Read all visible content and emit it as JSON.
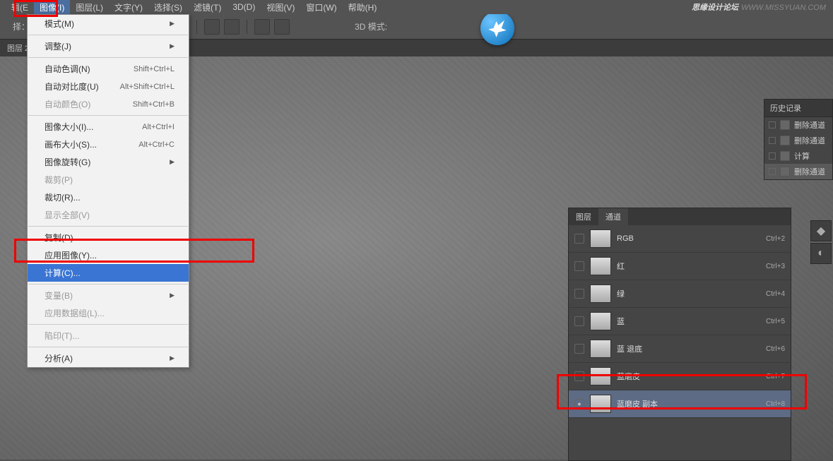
{
  "watermark": {
    "cn": "思缘设计论坛",
    "en": "WWW.MISSYUAN.COM"
  },
  "menubar": {
    "items": [
      {
        "label": "辑(E"
      },
      {
        "label": "图像(I)"
      },
      {
        "label": "图层(L)"
      },
      {
        "label": "文字(Y)"
      },
      {
        "label": "选择(S)"
      },
      {
        "label": "滤镜(T)"
      },
      {
        "label": "3D(D)"
      },
      {
        "label": "视图(V)"
      },
      {
        "label": "窗口(W)"
      },
      {
        "label": "帮助(H)"
      }
    ]
  },
  "optionsbar": {
    "select_label": "择：",
    "mode3d": "3D 模式:"
  },
  "tabstrip": {
    "tab0": "图层 2"
  },
  "dropdown": {
    "items": [
      {
        "label": "模式(M)",
        "arrow": true
      },
      {
        "sep": true
      },
      {
        "label": "调整(J)",
        "arrow": true
      },
      {
        "sep": true
      },
      {
        "label": "自动色调(N)",
        "kbd": "Shift+Ctrl+L"
      },
      {
        "label": "自动对比度(U)",
        "kbd": "Alt+Shift+Ctrl+L"
      },
      {
        "label": "自动颜色(O)",
        "kbd": "Shift+Ctrl+B",
        "disabled": true
      },
      {
        "sep": true
      },
      {
        "label": "图像大小(I)...",
        "kbd": "Alt+Ctrl+I"
      },
      {
        "label": "画布大小(S)...",
        "kbd": "Alt+Ctrl+C"
      },
      {
        "label": "图像旋转(G)",
        "arrow": true
      },
      {
        "label": "裁剪(P)",
        "disabled": true
      },
      {
        "label": "裁切(R)..."
      },
      {
        "label": "显示全部(V)",
        "disabled": true
      },
      {
        "sep": true
      },
      {
        "label": "复制(D)..."
      },
      {
        "label": "应用图像(Y)..."
      },
      {
        "label": "计算(C)...",
        "highlight": true
      },
      {
        "sep": true
      },
      {
        "label": "变量(B)",
        "arrow": true,
        "disabled": true
      },
      {
        "label": "应用数据组(L)...",
        "disabled": true
      },
      {
        "sep": true
      },
      {
        "label": "陷印(T)...",
        "disabled": true
      },
      {
        "sep": true
      },
      {
        "label": "分析(A)",
        "arrow": true
      }
    ]
  },
  "history": {
    "title": "历史记录",
    "rows": [
      {
        "label": "删除通道"
      },
      {
        "label": "删除通道"
      },
      {
        "label": "计算"
      },
      {
        "label": "删除通道",
        "active": true
      }
    ]
  },
  "channels": {
    "tabs": {
      "layers": "图层",
      "channels": "通道"
    },
    "rows": [
      {
        "name": "RGB",
        "kbd": "Ctrl+2"
      },
      {
        "name": "红",
        "kbd": "Ctrl+3"
      },
      {
        "name": "绿",
        "kbd": "Ctrl+4"
      },
      {
        "name": "蓝",
        "kbd": "Ctrl+5"
      },
      {
        "name": "蓝 退底",
        "kbd": "Ctrl+6"
      },
      {
        "name": "蓝磨皮",
        "kbd": "Ctrl+7"
      },
      {
        "name": "蓝磨皮 副本",
        "kbd": "Ctrl+8",
        "selected": true,
        "eye": true
      }
    ]
  }
}
